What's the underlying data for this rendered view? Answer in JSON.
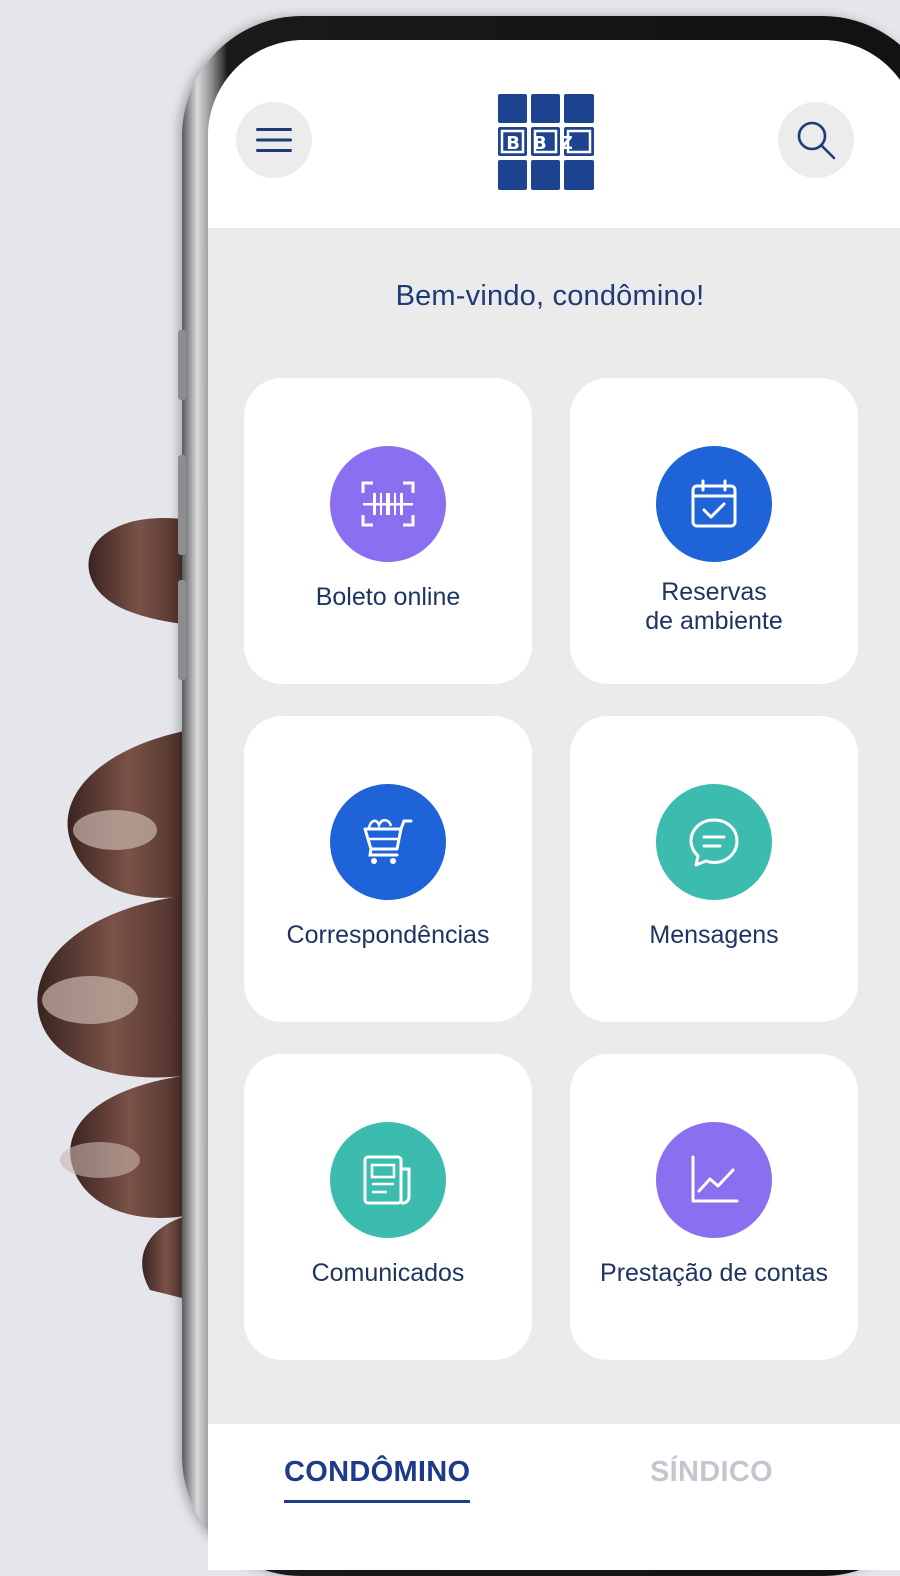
{
  "header": {
    "menu_icon": "hamburger-menu-icon",
    "logo_text": "BBZ",
    "search_icon": "search-icon"
  },
  "welcome": "Bem-vindo, condômino!",
  "cards": [
    {
      "label_line1": "Boleto online",
      "label_line2": "",
      "icon": "barcode-scan-icon",
      "color": "#8a6ff0"
    },
    {
      "label_line1": "Reservas",
      "label_line2": "de ambiente",
      "icon": "calendar-check-icon",
      "color": "#1f63d8"
    },
    {
      "label_line1": "Correspondências",
      "label_line2": "",
      "icon": "package-cart-icon",
      "color": "#1f63d8"
    },
    {
      "label_line1": "Mensagens",
      "label_line2": "",
      "icon": "chat-bubble-icon",
      "color": "#3bbcae"
    },
    {
      "label_line1": "Comunicados",
      "label_line2": "",
      "icon": "newspaper-icon",
      "color": "#3bbcae"
    },
    {
      "label_line1": "Prestação de contas",
      "label_line2": "",
      "icon": "line-chart-icon",
      "color": "#8a6ff0"
    }
  ],
  "tabs": {
    "active": "CONDÔMINO",
    "inactive": "SÍNDICO"
  },
  "colors": {
    "navy": "#1e3a78",
    "purple": "#8a6ff0",
    "blue": "#1f63d8",
    "teal": "#3bbcae",
    "logo_blue": "#1d4391"
  }
}
